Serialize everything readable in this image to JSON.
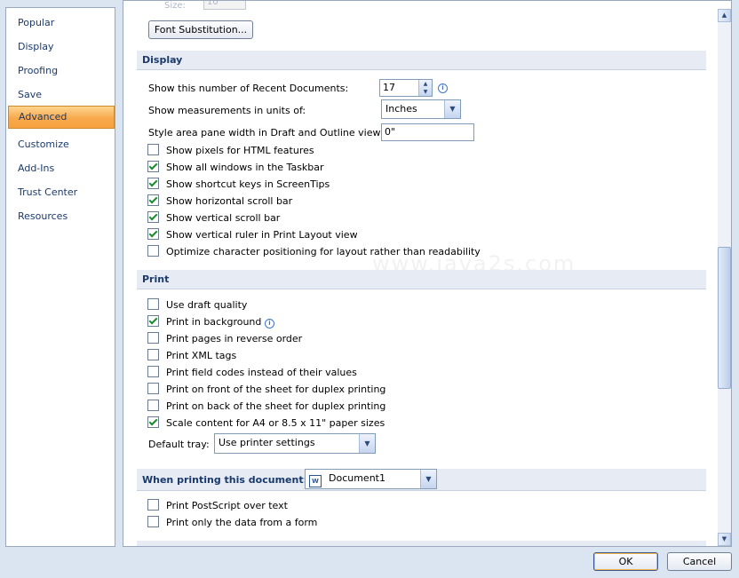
{
  "nav": {
    "items": [
      {
        "label": "Popular"
      },
      {
        "label": "Display"
      },
      {
        "label": "Proofing"
      },
      {
        "label": "Save"
      },
      {
        "label": "Advanced"
      },
      {
        "label": "Customize"
      },
      {
        "label": "Add-Ins"
      },
      {
        "label": "Trust Center"
      },
      {
        "label": "Resources"
      }
    ],
    "selected": "Advanced"
  },
  "top": {
    "size_label": "Size:",
    "size_value": "10",
    "font_substitution_button": "Font Substitution..."
  },
  "display": {
    "header": "Display",
    "recent_docs_label": "Show this number of Recent Documents:",
    "recent_docs_value": "17",
    "measurements_label": "Show measurements in units of:",
    "measurements_value": "Inches",
    "style_area_label": "Style area pane width in Draft and Outline views:",
    "style_area_value": "0\"",
    "checkboxes": [
      {
        "label": "Show pixels for HTML features",
        "checked": false
      },
      {
        "label": "Show all windows in the Taskbar",
        "checked": true
      },
      {
        "label": "Show shortcut keys in ScreenTips",
        "checked": true
      },
      {
        "label": "Show horizontal scroll bar",
        "checked": true
      },
      {
        "label": "Show vertical scroll bar",
        "checked": true
      },
      {
        "label": "Show vertical ruler in Print Layout view",
        "checked": true
      },
      {
        "label": "Optimize character positioning for layout rather than readability",
        "checked": false
      }
    ]
  },
  "print": {
    "header": "Print",
    "checkboxes": [
      {
        "label": "Use draft quality",
        "checked": false
      },
      {
        "label": "Print in background",
        "checked": true
      },
      {
        "label": "Print pages in reverse order",
        "checked": false
      },
      {
        "label": "Print XML tags",
        "checked": false
      },
      {
        "label": "Print field codes instead of their values",
        "checked": false
      },
      {
        "label": "Print on front of the sheet for duplex printing",
        "checked": false
      },
      {
        "label": "Print on back of the sheet for duplex printing",
        "checked": false
      },
      {
        "label": "Scale content for A4 or 8.5 x 11\" paper sizes",
        "checked": true
      }
    ],
    "default_tray_label": "Default tray:",
    "default_tray_value": "Use printer settings"
  },
  "when_printing": {
    "header": "When printing this document:",
    "document_value": "Document1",
    "checkboxes": [
      {
        "label": "Print PostScript over text",
        "checked": false
      },
      {
        "label": "Print only the data from a form",
        "checked": false
      }
    ]
  },
  "footer": {
    "ok_label": "OK",
    "cancel_label": "Cancel"
  },
  "watermark": "www.java2s.com"
}
